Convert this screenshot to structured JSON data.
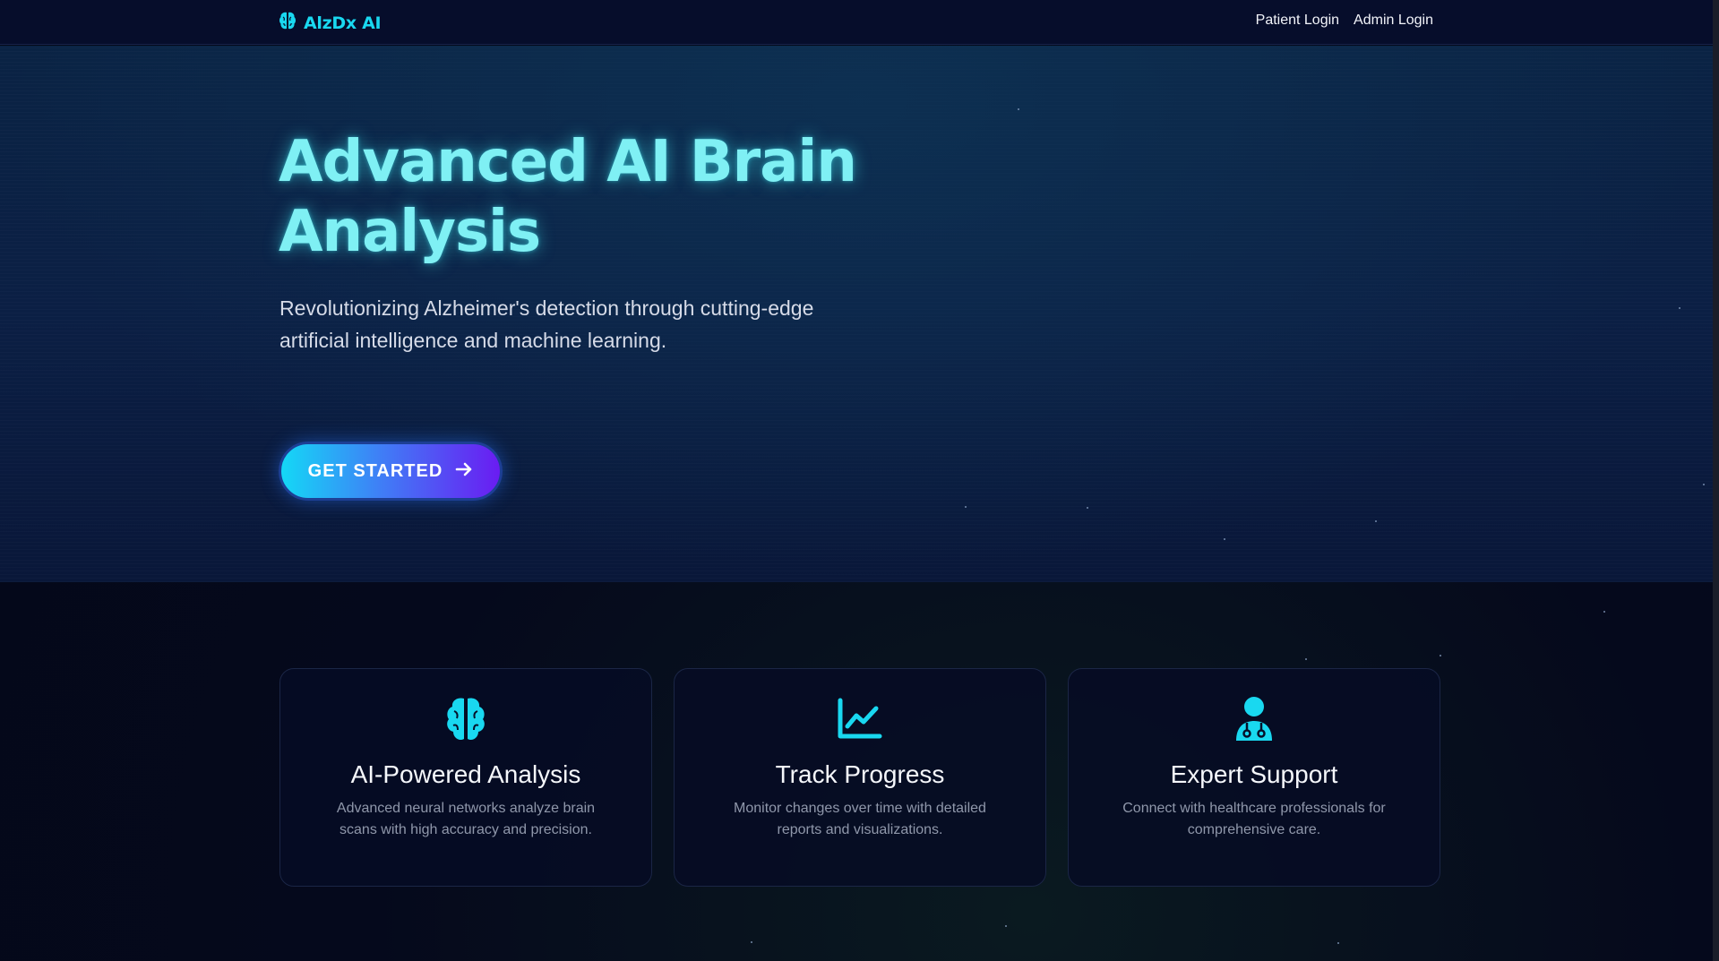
{
  "nav": {
    "brand": "AlzDx AI",
    "brand_icon": "brain-icon",
    "links": [
      "Patient Login",
      "Admin Login"
    ]
  },
  "hero": {
    "title": "Advanced AI Brain Analysis",
    "subtitle": "Revolutionizing Alzheimer's detection through cutting-edge artificial intelligence and machine learning.",
    "cta_label": "GET STARTED",
    "cta_icon": "arrow-right-icon"
  },
  "features": [
    {
      "icon": "brain-icon",
      "title": "AI-Powered Analysis",
      "description": "Advanced neural networks analyze brain scans with high accuracy and precision."
    },
    {
      "icon": "line-chart-icon",
      "title": "Track Progress",
      "description": "Monitor changes over time with detailed reports and visualizations."
    },
    {
      "icon": "doctor-icon",
      "title": "Expert Support",
      "description": "Connect with healthcare professionals for comprehensive care."
    }
  ],
  "colors": {
    "accent": "#19d8f0",
    "title_glow": "#7ff0f4",
    "cta_start": "#14d8f6",
    "cta_end": "#6a1cf2",
    "background": "#050a1e"
  }
}
